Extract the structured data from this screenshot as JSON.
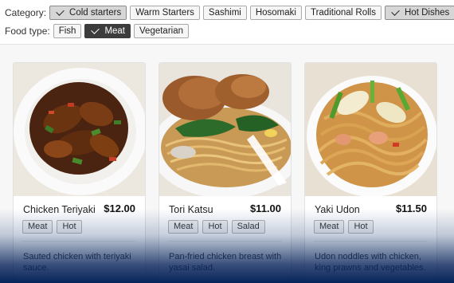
{
  "filters": {
    "category_label": "Category:",
    "categories": [
      {
        "label": "Cold starters",
        "checked": true
      },
      {
        "label": "Warm Starters",
        "checked": false
      },
      {
        "label": "Sashimi",
        "checked": false
      },
      {
        "label": "Hosomaki",
        "checked": false
      },
      {
        "label": "Traditional Rolls",
        "checked": false
      },
      {
        "label": "Hot Dishes",
        "checked": true
      }
    ],
    "food_type_label": "Food type:",
    "food_types": [
      {
        "label": "Fish",
        "checked": false
      },
      {
        "label": "Meat",
        "checked": true
      },
      {
        "label": "Vegetarian",
        "checked": false
      }
    ]
  },
  "dishes": [
    {
      "name": "Chicken Teriyaki",
      "price": "$12.00",
      "tags": [
        "Meat",
        "Hot"
      ],
      "description": "Sauted chicken with teriyaki sauce.",
      "photo_icon": "chicken-teriyaki-photo"
    },
    {
      "name": "Tori Katsu",
      "price": "$11.00",
      "tags": [
        "Meat",
        "Hot",
        "Salad"
      ],
      "description": "Pan-fried chicken breast with yasai salad.",
      "photo_icon": "tori-katsu-photo"
    },
    {
      "name": "Yaki Udon",
      "price": "$11.50",
      "tags": [
        "Meat",
        "Hot"
      ],
      "description": "Udon noddles with chicken, king prawns and vegetables.",
      "photo_icon": "yaki-udon-photo"
    }
  ],
  "colors": {
    "selected_chip": "#d6d6d6",
    "selected_chip_dark": "#3c3c3c",
    "overlay_bottom": "#05245a"
  }
}
